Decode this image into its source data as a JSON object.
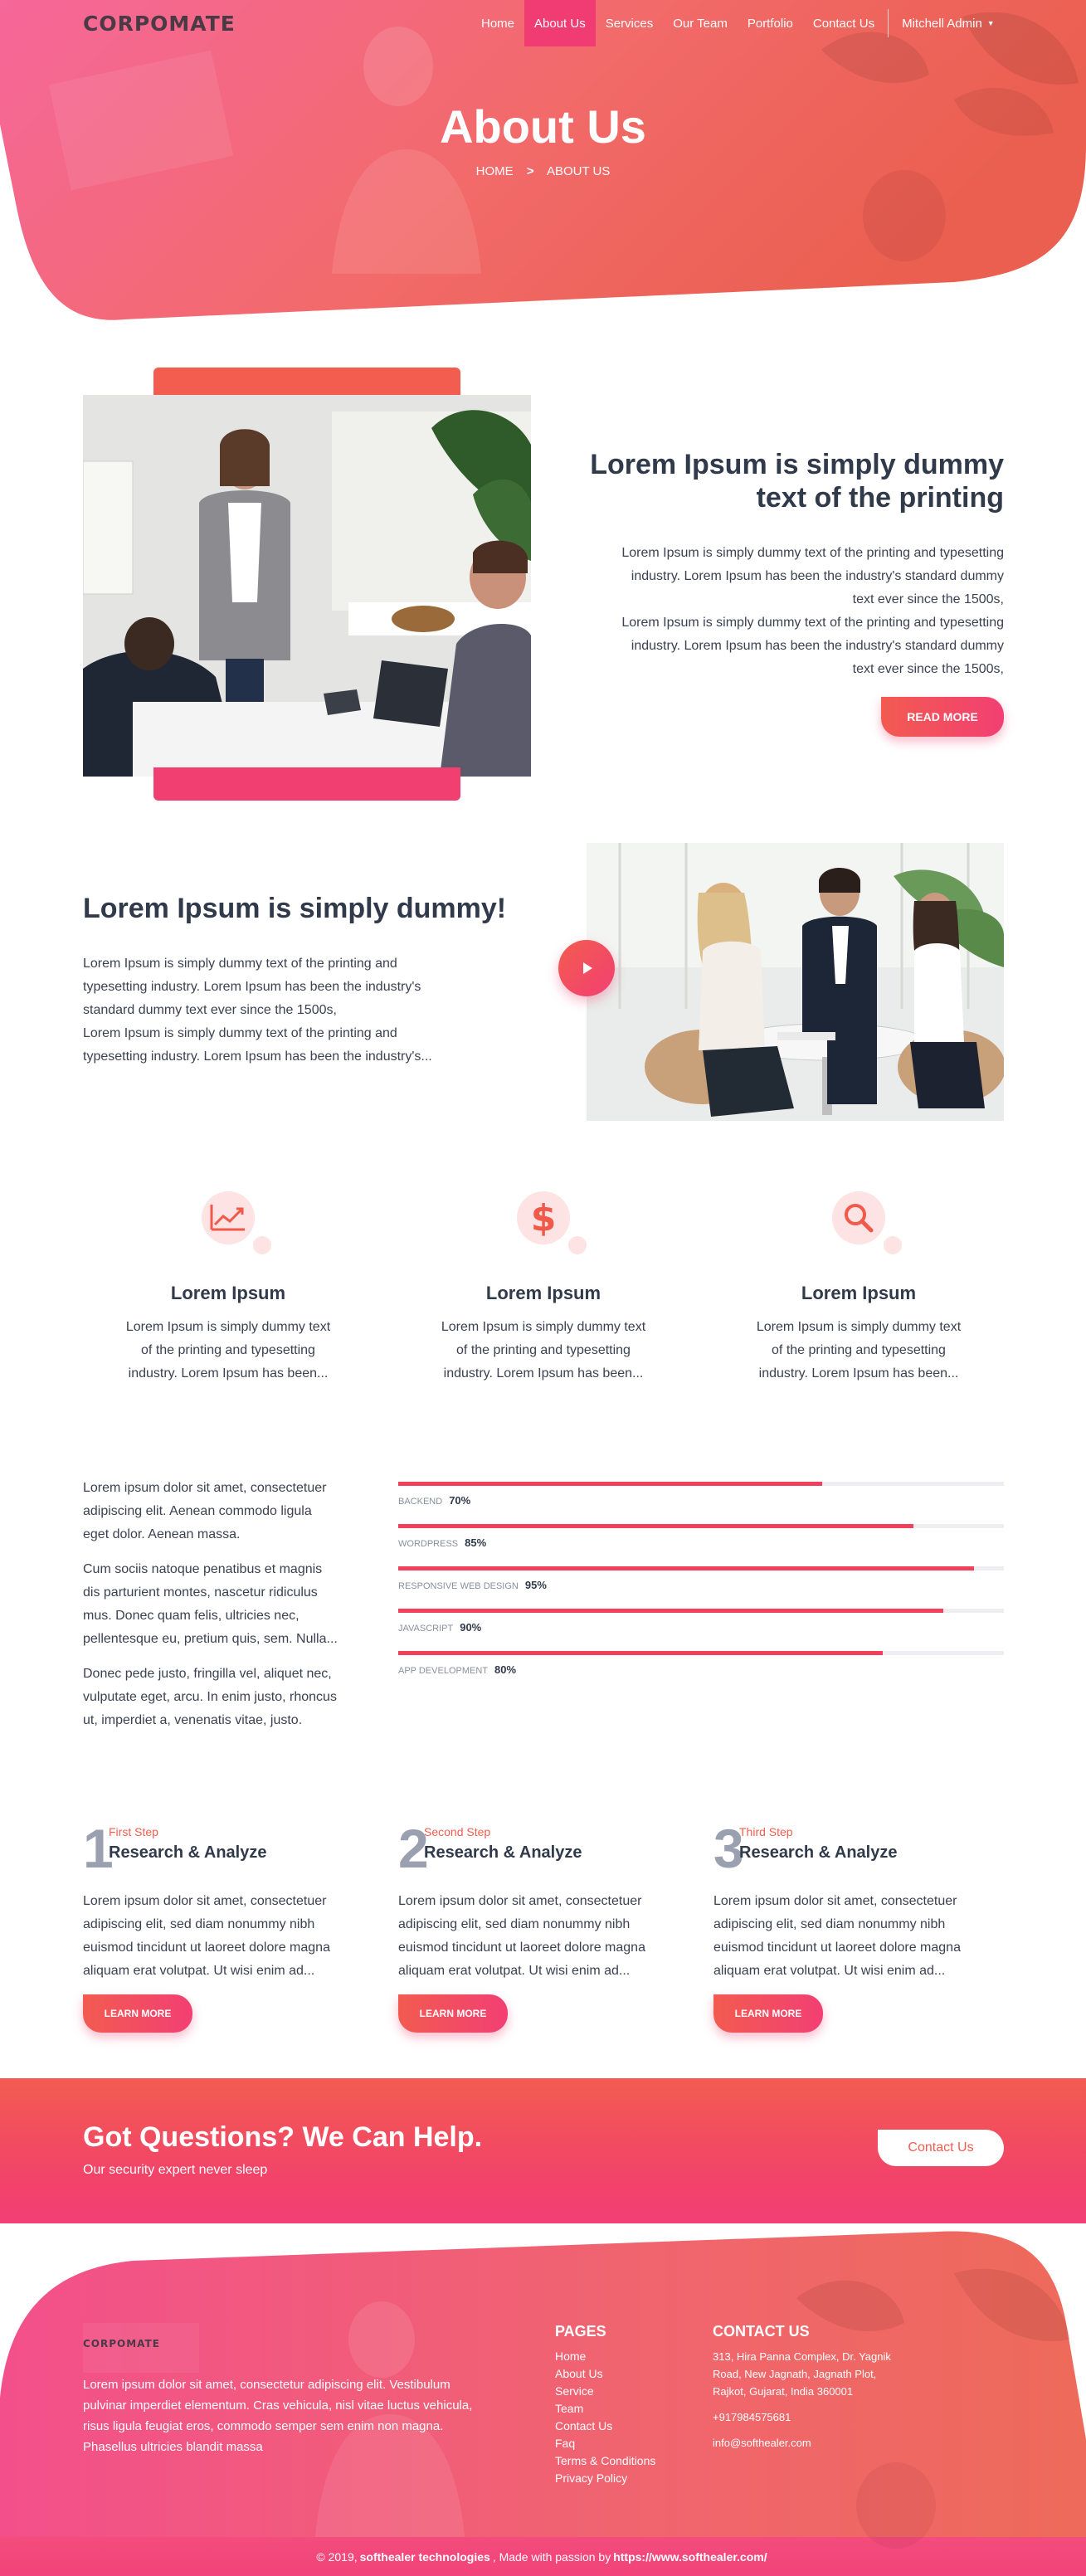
{
  "nav": {
    "logo": "CORPOMATE",
    "items": [
      "Home",
      "About Us",
      "Services",
      "Our Team",
      "Portfolio",
      "Contact Us"
    ],
    "user": "Mitchell Admin"
  },
  "hero": {
    "title": "About Us",
    "breadcrumb_home": "HOME",
    "breadcrumb_current": "ABOUT US"
  },
  "about1": {
    "heading_line1": "Lorem Ipsum is simply dummy",
    "heading_line2": "text of the printing",
    "lines": [
      "Lorem Ipsum is simply dummy text of the printing and typesetting",
      "industry. Lorem Ipsum has been the industry's standard dummy",
      "text ever since the 1500s,",
      "Lorem Ipsum is simply dummy text of the printing and typesetting",
      "industry. Lorem Ipsum has been the industry's standard dummy",
      "text ever since the 1500s,"
    ],
    "button": "READ MORE"
  },
  "about2": {
    "heading": "Lorem Ipsum is simply dummy!",
    "lines": [
      "Lorem Ipsum is simply dummy text of the printing and",
      "typesetting industry. Lorem Ipsum has been the industry's",
      "standard dummy text ever since the 1500s,",
      "Lorem Ipsum is simply dummy text of the printing and",
      "typesetting industry. Lorem Ipsum has been the industry's..."
    ]
  },
  "features": [
    {
      "icon": "chart-line-icon",
      "title": "Lorem Ipsum",
      "lines": [
        "Lorem Ipsum is simply dummy text",
        "of the printing and typesetting",
        "industry. Lorem Ipsum has been..."
      ]
    },
    {
      "icon": "dollar-icon",
      "title": "Lorem Ipsum",
      "lines": [
        "Lorem Ipsum is simply dummy text",
        "of the printing and typesetting",
        "industry. Lorem Ipsum has been..."
      ]
    },
    {
      "icon": "search-icon",
      "title": "Lorem Ipsum",
      "lines": [
        "Lorem Ipsum is simply dummy text",
        "of the printing and typesetting",
        "industry. Lorem Ipsum has been..."
      ]
    }
  ],
  "skills_text": {
    "p1": [
      "Lorem ipsum dolor sit amet, consectetuer",
      "adipiscing elit. Aenean commodo ligula",
      "eget dolor. Aenean massa."
    ],
    "p2": [
      "Cum sociis natoque penatibus et magnis",
      "dis parturient montes, nascetur ridiculus",
      "mus. Donec quam felis, ultricies nec,",
      "pellentesque eu, pretium quis, sem. Nulla..."
    ],
    "p3": [
      "Donec pede justo, fringilla vel, aliquet nec,",
      "vulputate eget, arcu. In enim justo, rhoncus",
      "ut, imperdiet a, venenatis vitae, justo."
    ]
  },
  "skills": [
    {
      "label": "BACKEND",
      "value": 70,
      "text": "70%"
    },
    {
      "label": "WORDPRESS",
      "value": 85,
      "text": "85%"
    },
    {
      "label": "RESPONSIVE WEB DESIGN",
      "value": 95,
      "text": "95%"
    },
    {
      "label": "JAVASCRIPT",
      "value": 90,
      "text": "90%"
    },
    {
      "label": "APP DEVELOPMENT",
      "value": 80,
      "text": "80%"
    }
  ],
  "steps": [
    {
      "num": "1",
      "sub": "First Step",
      "title": "Research & Analyze",
      "lines": [
        "Lorem ipsum dolor sit amet, consectetuer",
        "adipiscing elit, sed diam nonummy nibh",
        "euismod tincidunt ut laoreet dolore magna",
        "aliquam erat volutpat. Ut wisi enim ad..."
      ],
      "button": "LEARN MORE"
    },
    {
      "num": "2",
      "sub": "Second Step",
      "title": "Research & Analyze",
      "lines": [
        "Lorem ipsum dolor sit amet, consectetuer",
        "adipiscing elit, sed diam nonummy nibh",
        "euismod tincidunt ut laoreet dolore magna",
        "aliquam erat volutpat. Ut wisi enim ad..."
      ],
      "button": "LEARN MORE"
    },
    {
      "num": "3",
      "sub": "Third Step",
      "title": "Research & Analyze",
      "lines": [
        "Lorem ipsum dolor sit amet, consectetuer",
        "adipiscing elit, sed diam nonummy nibh",
        "euismod tincidunt ut laoreet dolore magna",
        "aliquam erat volutpat. Ut wisi enim ad..."
      ],
      "button": "LEARN MORE"
    }
  ],
  "cta": {
    "title": "Got Questions? We Can Help.",
    "subtitle": "Our security expert never sleep",
    "button": "Contact Us"
  },
  "footer": {
    "logo": "CORPOMATE",
    "text": [
      "Lorem ipsum dolor sit amet, consectetur adipiscing elit. Vestibulum",
      "pulvinar imperdiet elementum. Cras vehicula, nisl vitae luctus vehicula,",
      "risus ligula feugiat eros, commodo semper sem enim non magna.",
      "Phasellus ultricies blandit massa"
    ],
    "pages_heading": "PAGES",
    "pages": [
      "Home",
      "About Us",
      "Service",
      "Team",
      "Contact Us",
      "Faq",
      "Terms & Conditions",
      "Privacy Policy"
    ],
    "contact_heading": "CONTACT US",
    "address": [
      "313, Hira Panna Complex, Dr. Yagnik",
      "Road, New Jagnath, Jagnath Plot,",
      "Rajkot, Gujarat, India 360001"
    ],
    "phone": "+917984575681",
    "email": "info@softhealer.com"
  },
  "copyright": {
    "prefix": "© 2019,",
    "company": "softhealer technologies",
    "middle": ", Made with passion by",
    "link": "https://www.softhealer.com/"
  },
  "colors": {
    "accent_orange": "#f25d4f",
    "accent_pink": "#f23f72",
    "heading": "#313a4b"
  }
}
